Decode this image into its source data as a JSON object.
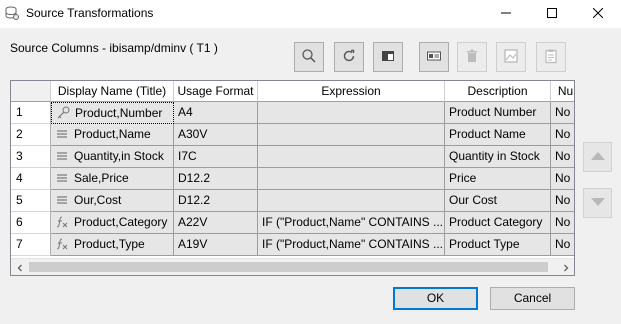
{
  "window": {
    "title": "Source Transformations",
    "icon": "database-icon",
    "controls": [
      "minimize-icon",
      "maximize-icon",
      "close-icon"
    ]
  },
  "section_label": "Source Columns - ibisamp/dminv ( T1 )",
  "toolbar": [
    {
      "name": "search-button",
      "icon": "search-icon",
      "enabled": true
    },
    {
      "name": "refresh-button",
      "icon": "refresh-icon",
      "enabled": true
    },
    {
      "name": "window-button",
      "icon": "window-icon",
      "enabled": true
    },
    {
      "name": "card-button",
      "icon": "card-icon",
      "enabled": true
    },
    {
      "name": "delete-button",
      "icon": "trash-icon",
      "enabled": false
    },
    {
      "name": "image-button",
      "icon": "image-icon",
      "enabled": false
    },
    {
      "name": "paste-button",
      "icon": "clipboard-icon",
      "enabled": false
    }
  ],
  "grid": {
    "columns": [
      "Display Name (Title)",
      "Usage Format",
      "Expression",
      "Description",
      "Nu"
    ],
    "rows": [
      {
        "num": "1",
        "icon": "key-icon",
        "display_name": "Product,Number",
        "format": "A4",
        "expression": "",
        "description": "Product Number",
        "extra": "No"
      },
      {
        "num": "2",
        "icon": "list-icon",
        "display_name": "Product,Name",
        "format": "A30V",
        "expression": "",
        "description": "Product Name",
        "extra": "No"
      },
      {
        "num": "3",
        "icon": "list-icon",
        "display_name": "Quantity,in Stock",
        "format": "I7C",
        "expression": "",
        "description": "Quantity in Stock",
        "extra": "No"
      },
      {
        "num": "4",
        "icon": "list-icon",
        "display_name": "Sale,Price",
        "format": "D12.2",
        "expression": "",
        "description": "Price",
        "extra": "No"
      },
      {
        "num": "5",
        "icon": "list-icon",
        "display_name": "Our,Cost",
        "format": "D12.2",
        "expression": "",
        "description": "Our Cost",
        "extra": "No"
      },
      {
        "num": "6",
        "icon": "function-icon",
        "display_name": "Product,Category",
        "format": "A22V",
        "expression": "IF (\"Product,Name\" CONTAINS ...",
        "description": "Product Category",
        "extra": "No"
      },
      {
        "num": "7",
        "icon": "function-icon",
        "display_name": "Product,Type",
        "format": "A19V",
        "expression": "IF (\"Product,Name\" CONTAINS ...",
        "description": "Product Type",
        "extra": "No"
      }
    ]
  },
  "side_buttons": [
    "move-up-button",
    "move-down-button"
  ],
  "buttons": {
    "ok": "OK",
    "cancel": "Cancel"
  },
  "colors": {
    "accent": "#0078d7",
    "cell_bg": "#e6e6e6",
    "dialog_bg": "#f0f0f0"
  }
}
